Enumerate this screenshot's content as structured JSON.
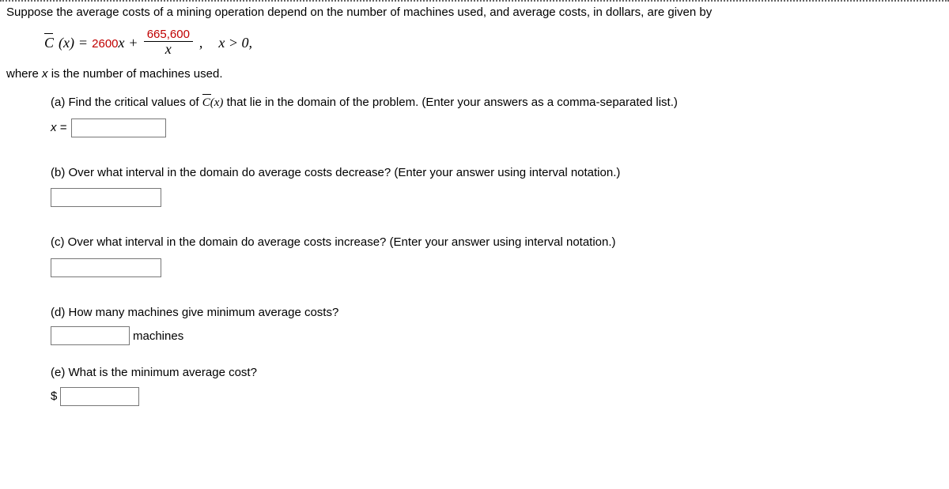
{
  "intro": "Suppose the average costs of a mining operation depend on the number of machines used, and average costs, in dollars, are given by",
  "formula": {
    "lhs_fn": "C",
    "lhs_arg": "(x)",
    "eq": " = ",
    "term1_coef": "2600",
    "term1_var": "x",
    "plus": " + ",
    "frac_num": "665,600",
    "frac_den": "x",
    "comma": ",",
    "cond": "x > 0,"
  },
  "where": "where x is the number of machines used.",
  "parts": {
    "a": {
      "label": "(a) ",
      "text": "Find the critical values of ",
      "fn": "C",
      "fnarg": "(x)",
      "text2": " that lie in the domain of the problem. (Enter your answers as a comma-separated list.)",
      "xeq": "x ="
    },
    "b": {
      "label": "(b) ",
      "text": "Over what interval in the domain do average costs decrease? (Enter your answer using interval notation.)"
    },
    "c": {
      "label": "(c) ",
      "text": "Over what interval in the domain do average costs increase? (Enter your answer using interval notation.)"
    },
    "d": {
      "label": "(d) ",
      "text": "How many machines give minimum average costs?",
      "unit": "machines"
    },
    "e": {
      "label": "(e) ",
      "text": "What is the minimum average cost?",
      "currency": "$"
    }
  }
}
